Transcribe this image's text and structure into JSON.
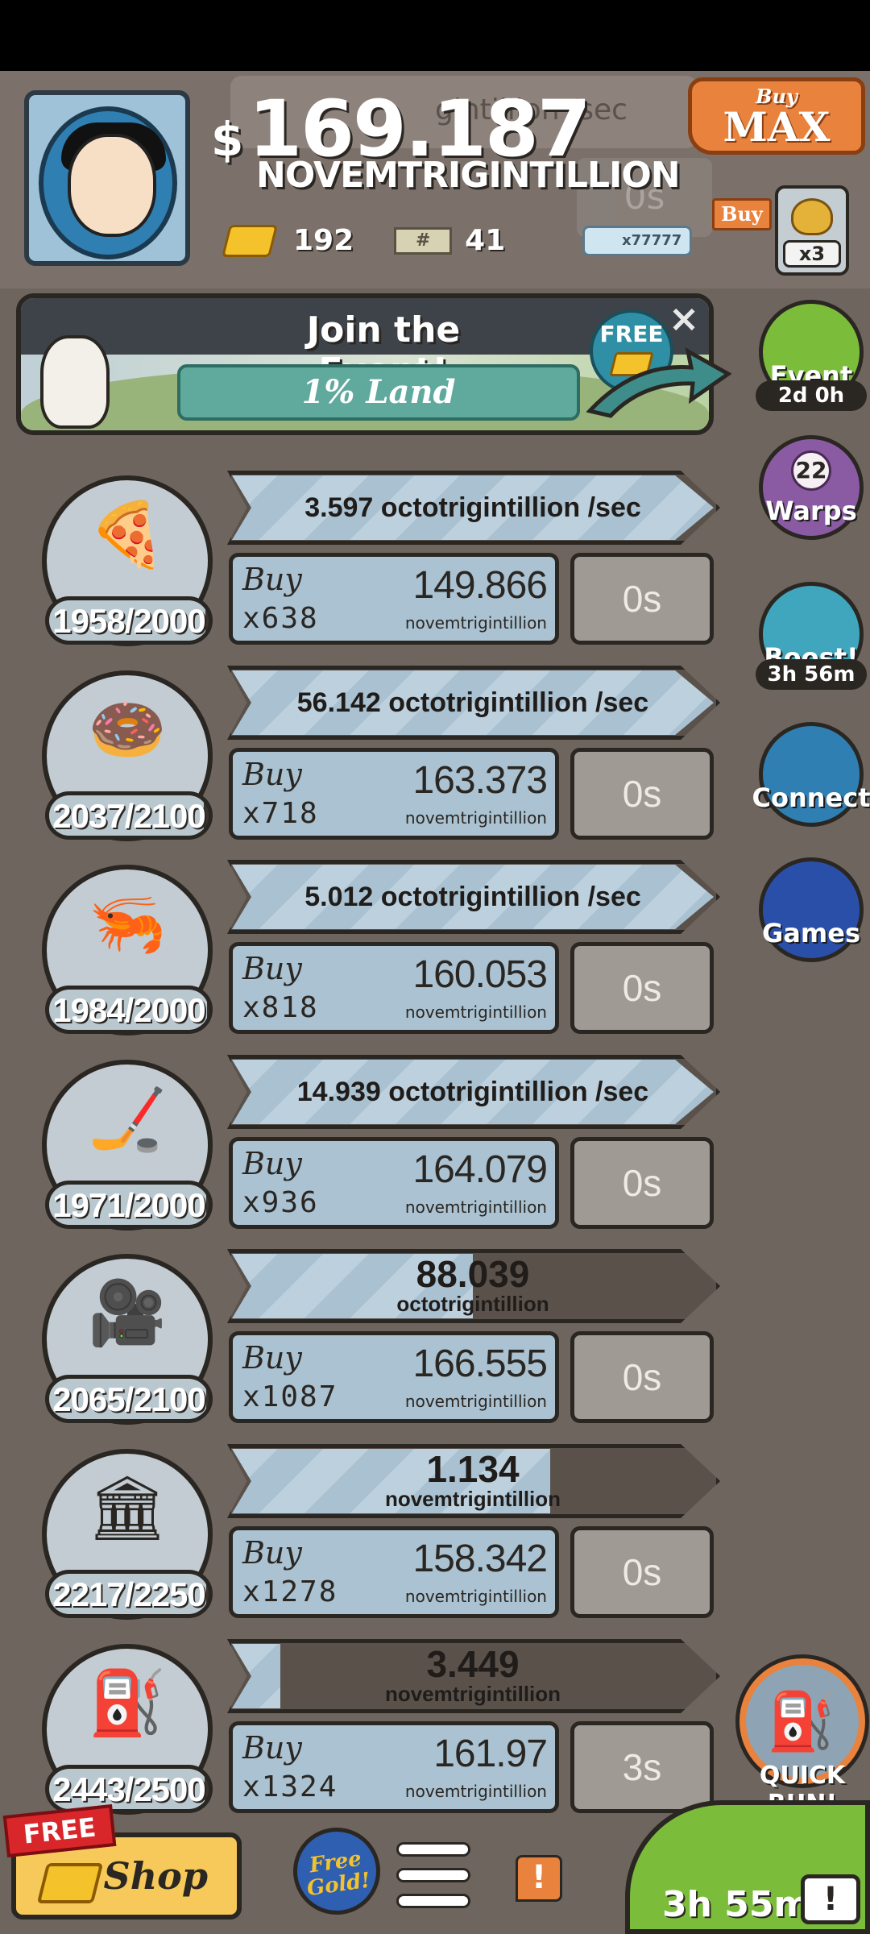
{
  "header": {
    "money_sign": "$",
    "money_value": "169.187",
    "money_unit": "NOVEMTRIGINTILLION",
    "ghost_rate": "gintillion /sec",
    "ghost_timer": "0s",
    "gold": "192",
    "tickets": "41",
    "ticket_mark": "#",
    "bill_label": "x77777",
    "buy_max_small": "Buy",
    "buy_max_big": "MAX",
    "buy_tag": "Buy",
    "moneybag_mult": "x3"
  },
  "event": {
    "title": "Join the Event!",
    "subtitle": "1% Land",
    "free_label": "FREE",
    "close": "×"
  },
  "side": {
    "event_label": "Event",
    "event_time": "2d 0h",
    "warps_count": "22",
    "warps_label": "Warps",
    "boost_label": "Boost!",
    "boost_time": "3h 56m",
    "connect_label": "Connect",
    "games_label": "Games"
  },
  "rows": [
    {
      "icon": "🍕",
      "icon_name": "pizza-icon",
      "count": "1958/2000",
      "count_fraction": 0.979,
      "rev_fraction": 1.0,
      "rev_single": "3.597 octotrigintillion /sec",
      "buy_word": "Buy",
      "mult": "x638",
      "cost": "149.866",
      "unit": "novemtrigintillion",
      "timer": "0s"
    },
    {
      "icon": "🍩",
      "icon_name": "donut-icon",
      "count": "2037/2100",
      "count_fraction": 0.97,
      "rev_fraction": 1.0,
      "rev_single": "56.142 octotrigintillion /sec",
      "buy_word": "Buy",
      "mult": "x718",
      "cost": "163.373",
      "unit": "novemtrigintillion",
      "timer": "0s"
    },
    {
      "icon": "🦐",
      "icon_name": "shrimp-icon",
      "count": "1984/2000",
      "count_fraction": 0.992,
      "rev_fraction": 1.0,
      "rev_single": "5.012 octotrigintillion /sec",
      "buy_word": "Buy",
      "mult": "x818",
      "cost": "160.053",
      "unit": "novemtrigintillion",
      "timer": "0s"
    },
    {
      "icon": "🏒",
      "icon_name": "hockey-stick-icon",
      "count": "1971/2000",
      "count_fraction": 0.985,
      "rev_fraction": 1.0,
      "rev_single": "14.939 octotrigintillion /sec",
      "buy_word": "Buy",
      "mult": "x936",
      "cost": "164.079",
      "unit": "novemtrigintillion",
      "timer": "0s"
    },
    {
      "icon": "🎥",
      "icon_name": "movie-camera-icon",
      "count": "2065/2100",
      "count_fraction": 0.983,
      "rev_fraction": 0.5,
      "rev_value": "88.039",
      "rev_unit": "octotrigintillion",
      "buy_word": "Buy",
      "mult": "x1087",
      "cost": "166.555",
      "unit": "novemtrigintillion",
      "timer": "0s"
    },
    {
      "icon": "🏛",
      "icon_name": "bank-icon",
      "count": "2217/2250",
      "count_fraction": 0.985,
      "rev_fraction": 0.66,
      "rev_value": "1.134",
      "rev_unit": "novemtrigintillion",
      "buy_word": "Buy",
      "mult": "x1278",
      "cost": "158.342",
      "unit": "novemtrigintillion",
      "timer": "0s"
    },
    {
      "icon": "⛽",
      "icon_name": "oil-derrick-icon",
      "count": "2443/2500",
      "count_fraction": 0.977,
      "rev_fraction": 0.1,
      "rev_value": "3.449",
      "rev_unit": "novemtrigintillion",
      "buy_word": "Buy",
      "mult": "x1324",
      "cost": "161.97",
      "unit": "novemtrigintillion",
      "timer": "3s"
    }
  ],
  "quickrun": {
    "label": "QUICK RUN!",
    "icon": "⛽"
  },
  "bottom": {
    "free_ribbon": "FREE",
    "shop_label": "Shop",
    "free_gold_1": "Free",
    "free_gold_2": "Gold!",
    "alert": "!",
    "tv_timer": "3h 55m",
    "tv_icon": "!"
  },
  "colors": {
    "background": "#6e655e",
    "accent_orange": "#e8823d",
    "bar_blue": "#aac2d1",
    "event_green": "#7bbd3a",
    "warps_purple": "#8a5aa3",
    "connect_blue": "#2f7fb3",
    "games_blue": "#2a4fa8"
  }
}
